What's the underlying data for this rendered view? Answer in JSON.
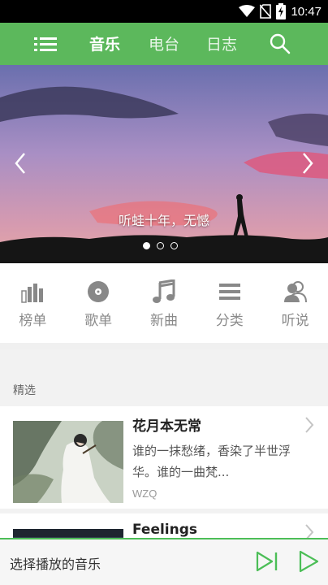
{
  "status_bar": {
    "time": "10:47"
  },
  "toolbar": {
    "tabs": [
      {
        "label": "音乐",
        "active": true
      },
      {
        "label": "电台",
        "active": false
      },
      {
        "label": "日志",
        "active": false
      }
    ],
    "accent_color": "#5cb85c"
  },
  "banner": {
    "caption": "听蛙十年，无憾",
    "page_count": 3,
    "active_page": 1
  },
  "categories": [
    {
      "label": "榜单",
      "icon": "bar-chart-icon"
    },
    {
      "label": "歌单",
      "icon": "disc-icon"
    },
    {
      "label": "新曲",
      "icon": "music-note-icon"
    },
    {
      "label": "分类",
      "icon": "list-icon"
    },
    {
      "label": "听说",
      "icon": "users-icon"
    }
  ],
  "featured": {
    "section_title": "精选",
    "songs": [
      {
        "title": "花月本无常",
        "description": "谁的一抹愁绪，香染了半世浮华。谁的一曲梵...",
        "author": "WZQ"
      },
      {
        "title": "Feelings",
        "description": "",
        "author": ""
      }
    ]
  },
  "player": {
    "now_playing": "选择播放的音乐",
    "accent_color": "#4cbe57"
  }
}
